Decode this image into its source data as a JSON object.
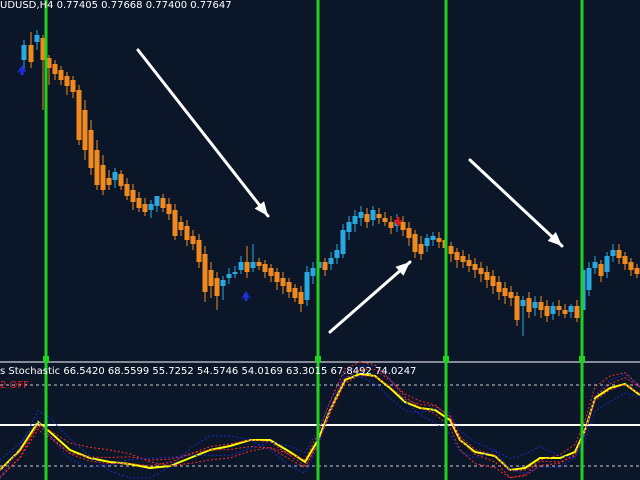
{
  "header": {
    "symbol": "UDUSD,H4",
    "ohlc": "0.77405 0.77668 0.77400 0.77647"
  },
  "indicator": {
    "header_prefix": "s Stochastic",
    "values": "66.5420 68.5599 55.7252 54.5746 54.0169 63.3015 67.8492 74.0247",
    "sub_label": "2 OFF"
  },
  "colors": {
    "background": "#0b1628",
    "bull_candle": "#29a8e0",
    "bear_candle": "#f08a1e",
    "vertical_line": "#22d11f",
    "arrow": "#ffffff",
    "stoch_main": "#ffff00",
    "stoch_dotted": "#ff2a2a",
    "stoch_blue": "#1a2bc9",
    "level_line": "#ffffff"
  },
  "chart_data": {
    "type": "candlestick",
    "panels": [
      "price",
      "stochastic"
    ],
    "indicator_levels": [
      80,
      50,
      20
    ],
    "indicator_range": [
      0,
      100
    ],
    "vertical_line_count": 4,
    "signal_arrows": [
      "buy",
      "buy",
      "sell"
    ],
    "trend_arrows": [
      "down",
      "up",
      "down"
    ]
  }
}
